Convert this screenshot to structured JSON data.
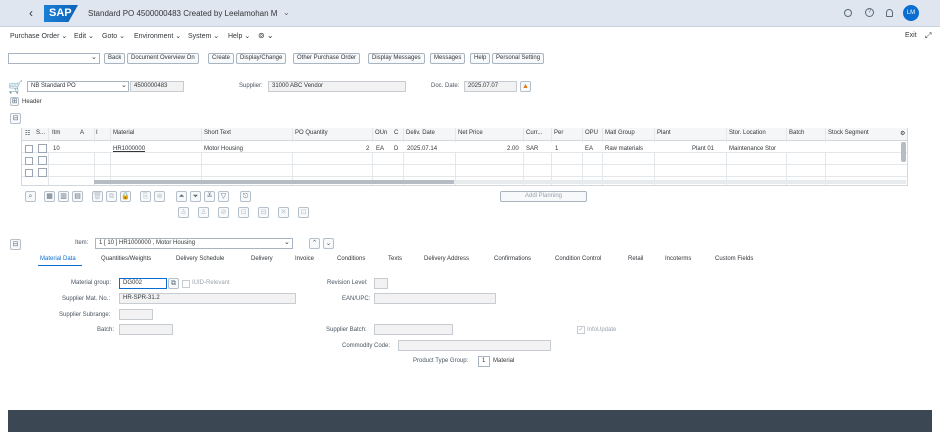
{
  "shell": {
    "logo": "SAP",
    "title": "Standard PO 4500000483 Created by Leelamohan M",
    "avatar_initials": "LM",
    "icons": [
      "back-icon",
      "search-icon",
      "help-icon",
      "notification-icon"
    ]
  },
  "menu": {
    "items": [
      "Purchase Order",
      "Edit",
      "Goto",
      "Environment",
      "System",
      "Help"
    ],
    "exit": "Exit"
  },
  "toolbar": {
    "buttons": [
      "Back",
      "Document Overview On",
      "Create",
      "Display/Change",
      "Other Purchase Order",
      "Display Messages",
      "Messages",
      "Help",
      "Personal Setting"
    ]
  },
  "header": {
    "doc_type": "NB Standard PO",
    "po_number": "4500000483",
    "supplier_label": "Supplier:",
    "supplier_value": "31000 ABC Vendor",
    "doc_date_label": "Doc. Date:",
    "doc_date_value": "2025.07.07",
    "header_label": "Header"
  },
  "items_table": {
    "columns": [
      "S...",
      "Itm",
      "A",
      "I",
      "Material",
      "Short Text",
      "PO Quantity",
      "OUn",
      "C",
      "Deliv. Date",
      "Net Price",
      "Curr...",
      "Per",
      "OPU",
      "Matl Group",
      "Plant",
      "Stor. Location",
      "Batch",
      "Stock Segment"
    ],
    "row": {
      "itm": "10",
      "material": "HR1000000",
      "short_text": "Motor Housing",
      "po_quantity": "2",
      "oun": "EA",
      "c": "D",
      "deliv_date": "2025.07.14",
      "net_price": "2.00",
      "currency": "SAR",
      "per": "1",
      "opu": "EA",
      "matl_group": "Raw materials",
      "plant": "Plant 01",
      "stor_location": "Maintenance Stor"
    },
    "addl_planning": "Addl Planning"
  },
  "item_detail": {
    "item_label": "Item:",
    "item_value": "1 [ 10 ] HR1000000 , Motor Housing",
    "tabs": [
      "Material Data",
      "Quantities/Weights",
      "Delivery Schedule",
      "Delivery",
      "Invoice",
      "Conditions",
      "Texts",
      "Delivery Address",
      "Confirmations",
      "Condition Control",
      "Retail",
      "Incoterms",
      "Custom Fields"
    ],
    "active_tab": "Material Data",
    "fields": {
      "material_group_label": "Material group:",
      "material_group_value": "DG002",
      "iuid_label": "IUID-Relevant",
      "revision_level_label": "Revision Level:",
      "supplier_mat_no_label": "Supplier Mat. No.:",
      "supplier_mat_no_value": "HR-SPR-31.2",
      "ean_upc_label": "EAN/UPC:",
      "supplier_subrange_label": "Supplier Subrange:",
      "batch_label": "Batch:",
      "supplier_batch_label": "Supplier Batch:",
      "info_update_label": "InfoUpdate",
      "commodity_code_label": "Commodity Code:",
      "product_type_group_label": "Product Type Group:",
      "product_type_group_value": "1",
      "product_type_group_text": "Material"
    }
  },
  "colors": {
    "shell_bg": "#dfe6ef",
    "accent": "#0a6ed1",
    "footer": "#3b4753",
    "warning": "#e9730c"
  }
}
